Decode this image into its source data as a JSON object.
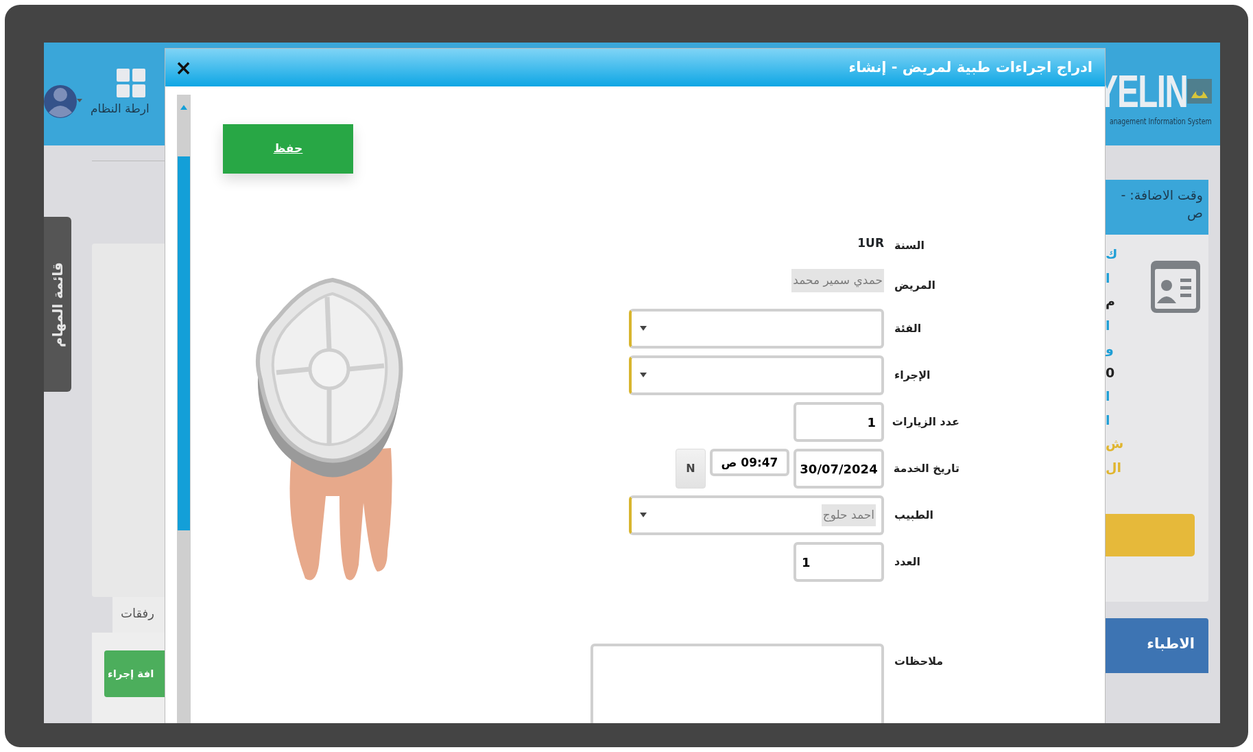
{
  "app_header": {
    "logo_text": "YELIN",
    "logo_subtitle": "anagement Information System",
    "system_map_label": "ارطة النظام"
  },
  "side_tab": {
    "label": "قائمة المهام"
  },
  "background_left": {
    "tab_label": "رفقات",
    "button_label": "افة إجراء"
  },
  "background_right": {
    "card_title": "وقت الاضافة: -",
    "card_title_line2": "ص",
    "fragments": [
      {
        "text": "ك",
        "color": "#1f9fd6"
      },
      {
        "text": "ا",
        "color": "#1f9fd6"
      },
      {
        "text": "م",
        "color": "#222222"
      },
      {
        "text": "ا",
        "color": "#1f9fd6"
      },
      {
        "text": "و",
        "color": "#1f9fd6"
      },
      {
        "text": "0",
        "color": "#222222"
      },
      {
        "text": "ا",
        "color": "#1f9fd6"
      },
      {
        "text": "ا",
        "color": "#1f9fd6"
      },
      {
        "text": "ش",
        "color": "#e0b52f"
      },
      {
        "text": "ال",
        "color": "#e0b52f"
      }
    ],
    "doctors_header": "الاطباء"
  },
  "dialog": {
    "title": "ادراج اجراءات طبية لمريض - إنشاء",
    "close": "×",
    "save_button": "حفظ",
    "fields": [
      {
        "kind": "static",
        "label": "السنة",
        "value": "1UR"
      },
      {
        "kind": "static",
        "label": "المريض",
        "value": "حمدي سمير محمد",
        "blurred": true
      },
      {
        "kind": "select",
        "label": "الفئة"
      },
      {
        "kind": "select",
        "label": "الإجراء"
      },
      {
        "kind": "number",
        "label": "عدد الزيارات",
        "value": "1"
      },
      {
        "kind": "datetime",
        "label": "تاريخ الخدمة",
        "value": "30/07/2024",
        "time": "09:47 ص",
        "now_button": "N"
      },
      {
        "kind": "select",
        "label": "الطبيب",
        "value": "احمد حلوج",
        "blurred": true
      },
      {
        "kind": "count",
        "label": "العدد",
        "value": "1"
      },
      {
        "kind": "textarea",
        "label": "ملاحظات"
      }
    ]
  }
}
